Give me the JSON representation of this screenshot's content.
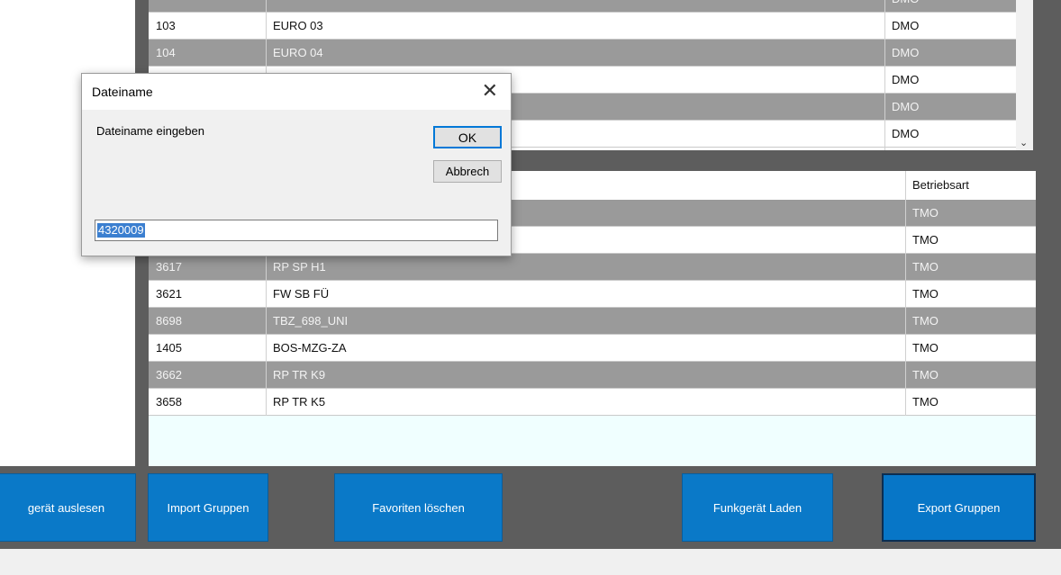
{
  "top_grid": {
    "rows": [
      {
        "id": "",
        "name": "",
        "mode": "DMO",
        "alt": true
      },
      {
        "id": "103",
        "name": "EURO 03",
        "mode": "DMO",
        "alt": false
      },
      {
        "id": "104",
        "name": "EURO 04",
        "mode": "DMO",
        "alt": true
      },
      {
        "id": "",
        "name": "",
        "mode": "DMO",
        "alt": false
      },
      {
        "id": "",
        "name": "",
        "mode": "DMO",
        "alt": true
      },
      {
        "id": "",
        "name": "",
        "mode": "DMO",
        "alt": false
      }
    ]
  },
  "bottom_grid": {
    "header": {
      "mode": "Betriebsart"
    },
    "rows": [
      {
        "id": "",
        "name": "",
        "mode": "TMO",
        "alt": true
      },
      {
        "id": "",
        "name": "",
        "mode": "TMO",
        "alt": false
      },
      {
        "id": "3617",
        "name": "RP SP H1",
        "mode": "TMO",
        "alt": true
      },
      {
        "id": "3621",
        "name": "FW SB FÜ",
        "mode": "TMO",
        "alt": false
      },
      {
        "id": "8698",
        "name": "TBZ_698_UNI",
        "mode": "TMO",
        "alt": true
      },
      {
        "id": "1405",
        "name": "BOS-MZG-ZA",
        "mode": "TMO",
        "alt": false
      },
      {
        "id": "3662",
        "name": "RP TR K9",
        "mode": "TMO",
        "alt": true
      },
      {
        "id": "3658",
        "name": "RP TR K5",
        "mode": "TMO",
        "alt": false
      }
    ]
  },
  "buttons": {
    "read_device": "gerät auslesen",
    "import_groups": "Import Gruppen",
    "delete_favorites": "Favoriten löschen",
    "load_device": "Funkgerät Laden",
    "export_groups": "Export Gruppen"
  },
  "dialog": {
    "title": "Dateiname",
    "close_glyph": "✕",
    "prompt": "Dateiname eingeben",
    "ok_label": "OK",
    "cancel_label": "Abbrech",
    "input_value": "4320009"
  },
  "icons": {
    "scroll_down": "⌄"
  },
  "colors": {
    "button_blue": "#0a79c8",
    "alt_row_gray": "#9a9a9a",
    "selection_blue": "#3b7fd0"
  }
}
